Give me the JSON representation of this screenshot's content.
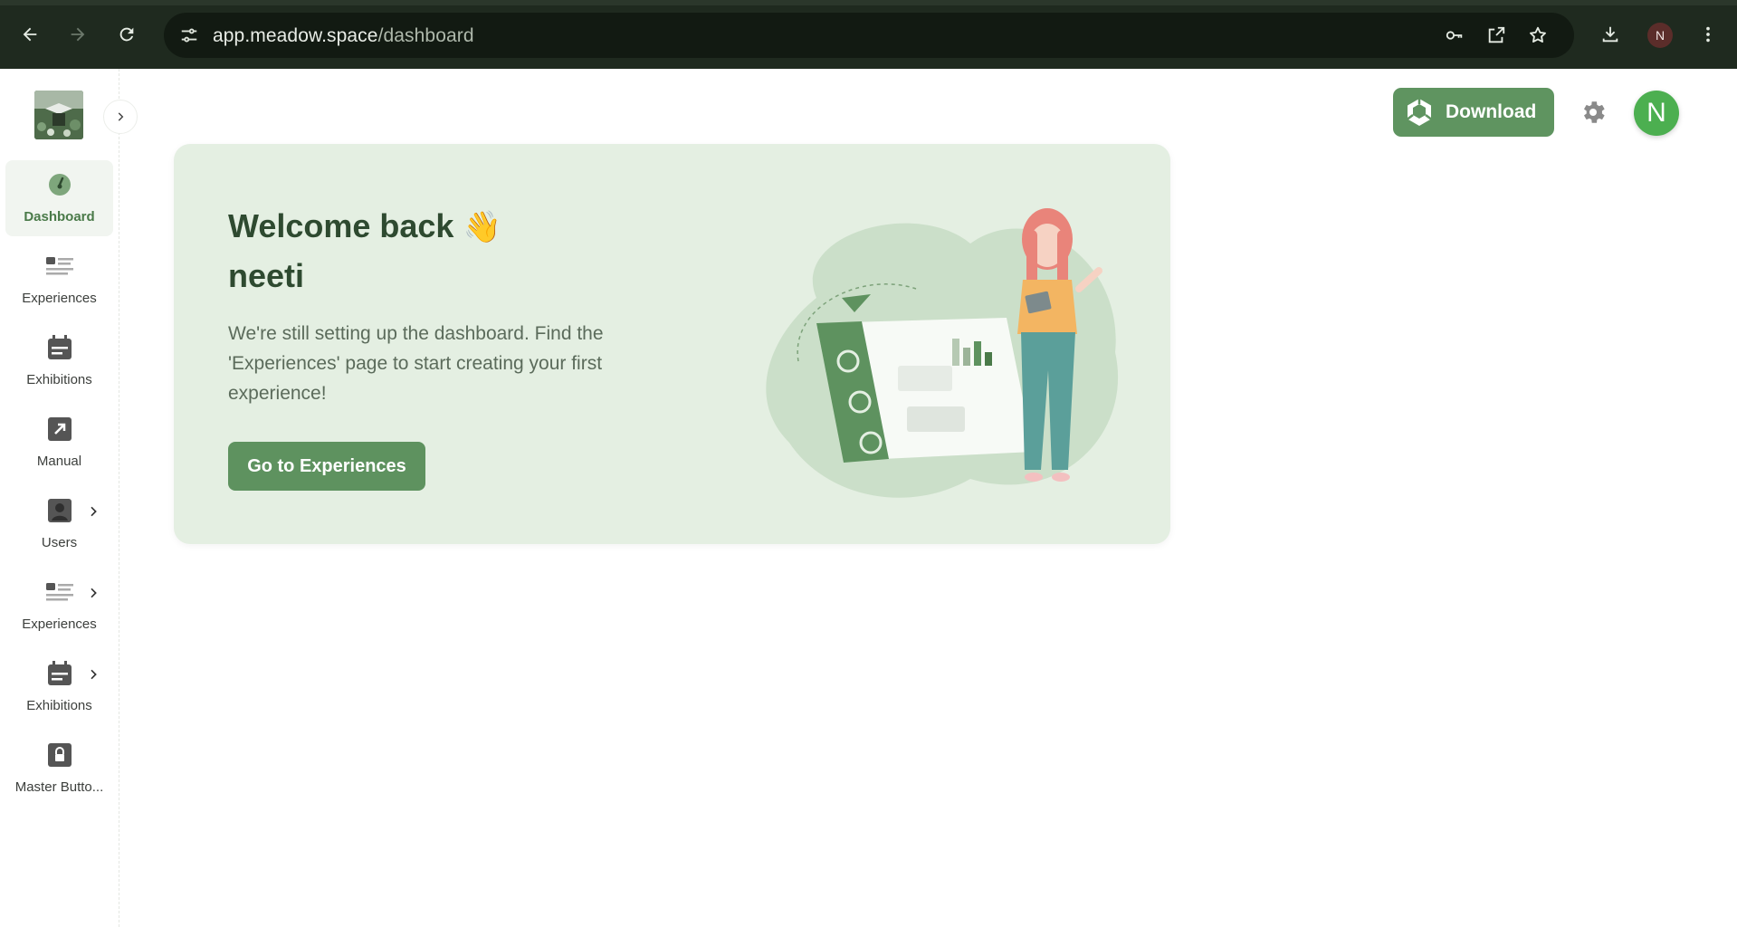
{
  "browser": {
    "url_domain": "app.meadow.space",
    "url_path": "/dashboard",
    "profile_initial": "N"
  },
  "sidebar": {
    "items": [
      {
        "label": "Dashboard",
        "icon": "gauge-icon",
        "active": true
      },
      {
        "label": "Experiences",
        "icon": "list-icon"
      },
      {
        "label": "Exhibitions",
        "icon": "calendar-icon"
      },
      {
        "label": "Manual",
        "icon": "external-link-icon"
      },
      {
        "label": "Users",
        "icon": "user-icon",
        "expandable": true
      },
      {
        "label": "Experiences",
        "icon": "list-icon",
        "expandable": true
      },
      {
        "label": "Exhibitions",
        "icon": "calendar-icon",
        "expandable": true
      },
      {
        "label": "Master Butto...",
        "icon": "lock-icon"
      }
    ]
  },
  "header": {
    "download_label": "Download",
    "avatar_initial": "N"
  },
  "welcome": {
    "title": "Welcome back",
    "wave_emoji": "👋",
    "name": "neeti",
    "message": "We're still setting up the dashboard. Find the 'Experiences' page to start creating your first experience!",
    "cta_label": "Go to Experiences"
  },
  "colors": {
    "accent": "#5f9460",
    "card_bg": "#e4efe2",
    "avatar": "#4caf50"
  }
}
